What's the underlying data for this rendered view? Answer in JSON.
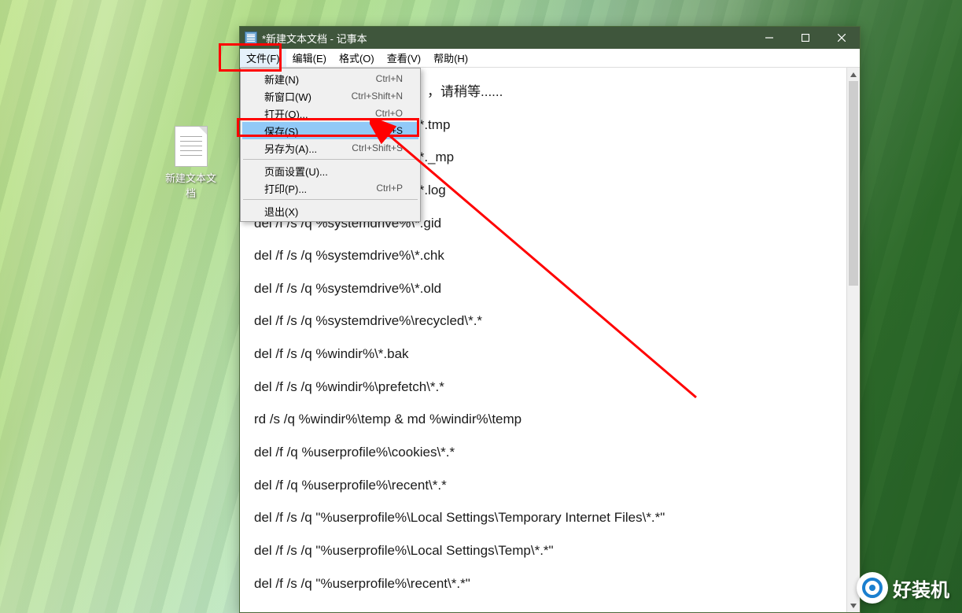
{
  "desktop": {
    "icon_label": "新建文本文档"
  },
  "window": {
    "title": "*新建文本文档 - 记事本"
  },
  "menubar": {
    "file": "文件(F)",
    "edit": "编辑(E)",
    "format": "格式(O)",
    "view": "查看(V)",
    "help": "帮助(H)"
  },
  "file_menu": {
    "new_label": "新建(N)",
    "new_kb": "Ctrl+N",
    "new_window_label": "新窗口(W)",
    "new_window_kb": "Ctrl+Shift+N",
    "open_label": "打开(O)...",
    "open_kb": "Ctrl+O",
    "save_label": "保存(S)",
    "save_kb": "Ctrl+S",
    "save_as_label": "另存为(A)...",
    "save_as_kb": "Ctrl+Shift+S",
    "page_setup_label": "页面设置(U)...",
    "print_label": "打印(P)...",
    "print_kb": "Ctrl+P",
    "exit_label": "退出(X)"
  },
  "content": {
    "line0": "，请稍等......",
    "line1": "\\*.tmp",
    "line2": "\\*._mp",
    "line3": "\\*.log",
    "line4": "del /f /s /q %systemdrive%\\*.gid",
    "line5": "del /f /s /q %systemdrive%\\*.chk",
    "line6": "del /f /s /q %systemdrive%\\*.old",
    "line7": "del /f /s /q %systemdrive%\\recycled\\*.*",
    "line8": "del /f /s /q %windir%\\*.bak",
    "line9": "del /f /s /q %windir%\\prefetch\\*.*",
    "line10": "rd /s /q %windir%\\temp & md %windir%\\temp",
    "line11": "del /f /q %userprofile%\\cookies\\*.*",
    "line12": "del /f /q %userprofile%\\recent\\*.*",
    "line13": "del /f /s /q \"%userprofile%\\Local Settings\\Temporary Internet Files\\*.*\"",
    "line14": "del /f /s /q \"%userprofile%\\Local Settings\\Temp\\*.*\"",
    "line15": "del /f /s /q \"%userprofile%\\recent\\*.*\""
  },
  "watermark": {
    "text": "好装机"
  }
}
